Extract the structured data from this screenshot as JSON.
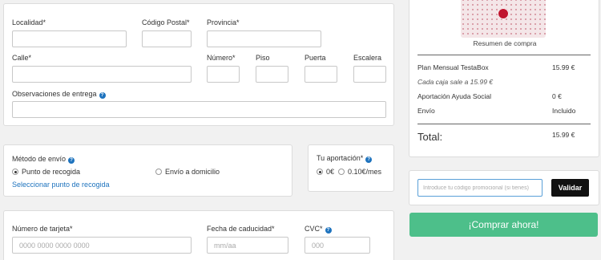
{
  "address": {
    "localidad": "Localidad*",
    "codigo_postal": "Código Postal*",
    "provincia": "Provincia*",
    "calle": "Calle*",
    "numero": "Número*",
    "piso": "Piso",
    "puerta": "Puerta",
    "escalera": "Escalera",
    "observaciones": "Observaciones de entrega"
  },
  "shipping": {
    "title": "Método de envío",
    "option_pickup": "Punto de recogida",
    "option_home": "Envío a domicilio",
    "select_point_link": "Seleccionar punto de recogida"
  },
  "contribution": {
    "title": "Tu aportación*",
    "option_zero": "0€",
    "option_month": "0.10€/mes"
  },
  "payment": {
    "card_label": "Número de tarjeta*",
    "card_placeholder": "0000 0000 0000 0000",
    "expiry_label": "Fecha de caducidad*",
    "expiry_placeholder": "mm/aa",
    "cvc_label": "CVC*",
    "cvc_placeholder": "000"
  },
  "summary": {
    "image_caption": "Resumen de compra",
    "rows": [
      {
        "label": "Plan Mensual TestaBox",
        "value": "15.99 €"
      },
      {
        "label": "Cada caja sale a 15.99 €",
        "value": ""
      },
      {
        "label": "Aportación Ayuda Social",
        "value": "0 €"
      },
      {
        "label": "Envío",
        "value": "Incluido"
      }
    ],
    "total_label": "Total:",
    "total_value": "15.99 €"
  },
  "promo": {
    "placeholder": "Introduce tu código promocional (si tienes)",
    "validate_button": "Validar"
  },
  "buy_button": "¡Comprar ahora!",
  "colors": {
    "accent_green": "#4dbf8a",
    "link_blue": "#1e73be",
    "promo_border": "#5aa0d8"
  }
}
